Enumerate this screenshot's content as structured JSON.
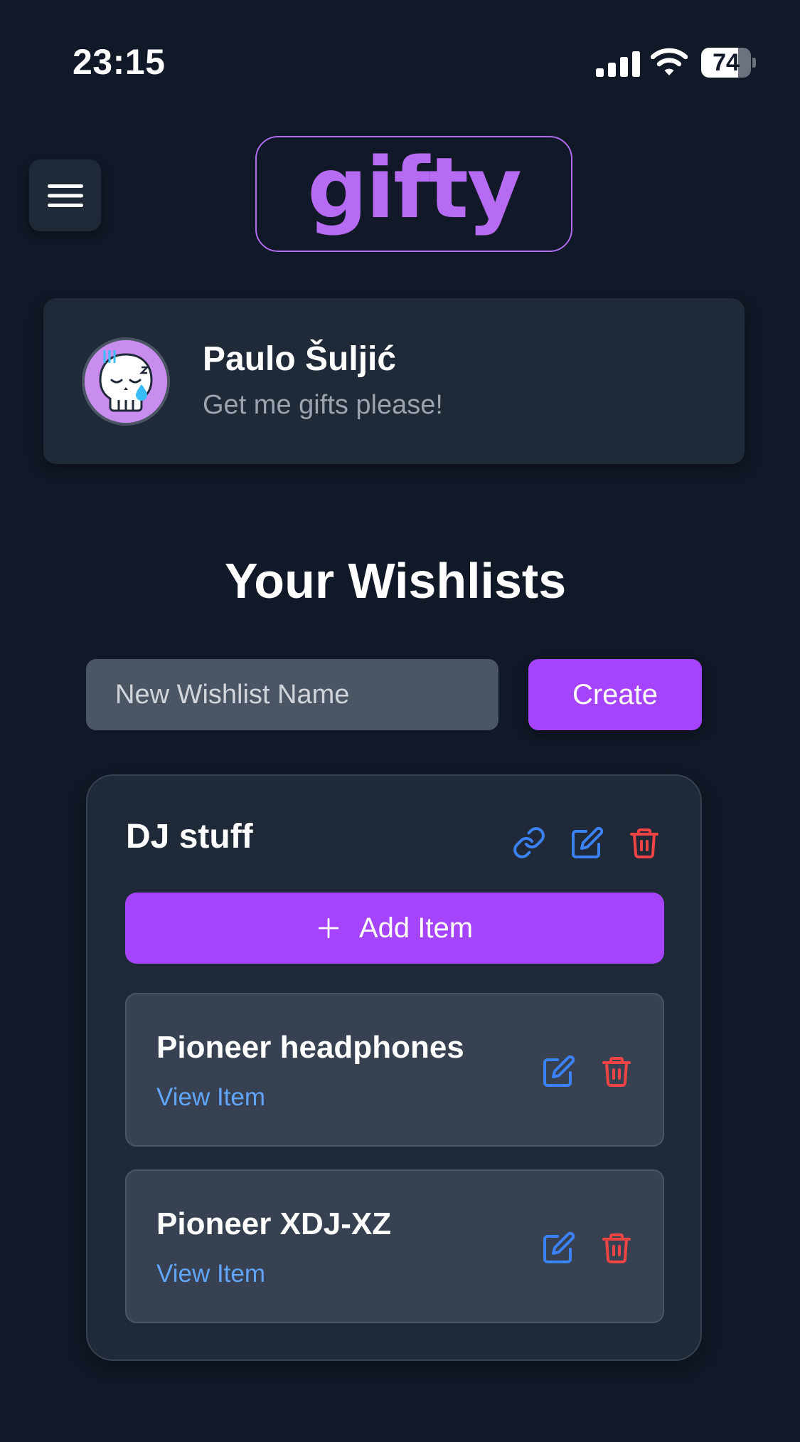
{
  "status_bar": {
    "time": "23:15",
    "battery": "74",
    "battery_level": 0.74
  },
  "header": {
    "menu_icon": "hamburger-menu-icon",
    "logo_text": "gifty"
  },
  "profile": {
    "name": "Paulo Šuljić",
    "tagline": "Get me gifts please!",
    "avatar_icon": "sleepy-skull-avatar"
  },
  "wishlists": {
    "title": "Your Wishlists",
    "new_input_placeholder": "New Wishlist Name",
    "create_label": "Create",
    "lists": [
      {
        "name": "DJ stuff",
        "actions": [
          "link-icon",
          "edit-icon",
          "trash-icon"
        ],
        "add_item_label": "Add Item",
        "items": [
          {
            "name": "Pioneer headphones",
            "link_label": "View Item"
          },
          {
            "name": "Pioneer XDJ-XZ",
            "link_label": "View Item"
          }
        ]
      }
    ]
  },
  "colors": {
    "background": "#111827",
    "card": "#1f2937",
    "accent_purple": "#a644fb",
    "logo_purple": "#b76bf3",
    "link_blue": "#60a5fa",
    "icon_blue": "#3b82f6",
    "icon_red": "#ef4444"
  }
}
